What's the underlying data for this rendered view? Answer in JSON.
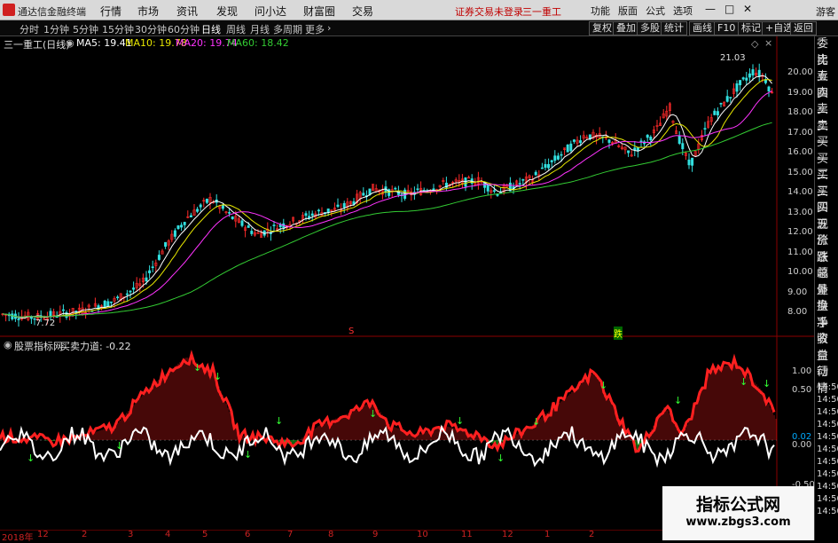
{
  "app": {
    "title": "通达信金融终端",
    "login_status": "证券交易未登录",
    "stock_name": "三一重工",
    "guest": "游客"
  },
  "menu": [
    "行情",
    "市场",
    "资讯",
    "发现",
    "问小达",
    "财富圈",
    "交易"
  ],
  "tools": [
    "功能",
    "版面",
    "公式",
    "选项"
  ],
  "periods": [
    {
      "label": "分时",
      "active": false
    },
    {
      "label": "1分钟",
      "active": false
    },
    {
      "label": "5分钟",
      "active": false
    },
    {
      "label": "15分钟",
      "active": false
    },
    {
      "label": "30分钟",
      "active": false
    },
    {
      "label": "60分钟",
      "active": false
    },
    {
      "label": "日线",
      "active": true
    },
    {
      "label": "周线",
      "active": false
    },
    {
      "label": "月线",
      "active": false
    },
    {
      "label": "多周期",
      "active": false
    },
    {
      "label": "更多",
      "active": false
    }
  ],
  "right_buttons": [
    "复权",
    "叠加",
    "多股",
    "统计",
    "画线",
    "F10",
    "标记",
    "+自选",
    "返回"
  ],
  "legend": {
    "title": "三一重工(日线)",
    "ma5": "MA5: 19.41",
    "ma10": "MA10: 19.78",
    "ma20": "MA20: 19.74",
    "ma60": "MA60: 18.42"
  },
  "colors": {
    "up": "#ff2a2a",
    "down": "#32e0e0",
    "ma5": "#ffffff",
    "ma10": "#e8e800",
    "ma20": "#ff33ff",
    "ma60": "#33cc33"
  },
  "price_axis": [
    "20.00",
    "19.00",
    "18.00",
    "17.00",
    "16.00",
    "15.00",
    "14.00",
    "13.00",
    "12.00",
    "11.00",
    "10.00",
    "9.00",
    "8.00"
  ],
  "price_marks": {
    "high": "21.03",
    "low": "7.72"
  },
  "markers": {
    "s": "S",
    "die": "跌"
  },
  "indicator": {
    "name": "股票指标网",
    "line_label": "买卖力道: -0.22",
    "axis": [
      "1.00",
      "0.50",
      "0.02",
      "0.00",
      "-0.50"
    ]
  },
  "sidebar": [
    "委比",
    "卖五",
    "卖四",
    "卖三",
    "卖二",
    "卖一",
    "买一",
    "买二",
    "买三",
    "买四",
    "买五",
    "现价",
    "涨跌",
    "涨幅",
    "总量",
    "外盘",
    "换手",
    "净资",
    "收益",
    "自动",
    "行情",
    "14:50",
    "14:50",
    "14:50",
    "14:50",
    "14:50",
    "14:50",
    "14:50",
    "14:50",
    "14:50",
    "14:50",
    "14:50"
  ],
  "dates": [
    "2018年",
    "12",
    "2",
    "3",
    "4",
    "5",
    "6",
    "7",
    "8",
    "9",
    "10",
    "11",
    "12",
    "1",
    "2"
  ],
  "watermark": {
    "title": "指标公式网",
    "url": "www.zbgs3.com"
  }
}
